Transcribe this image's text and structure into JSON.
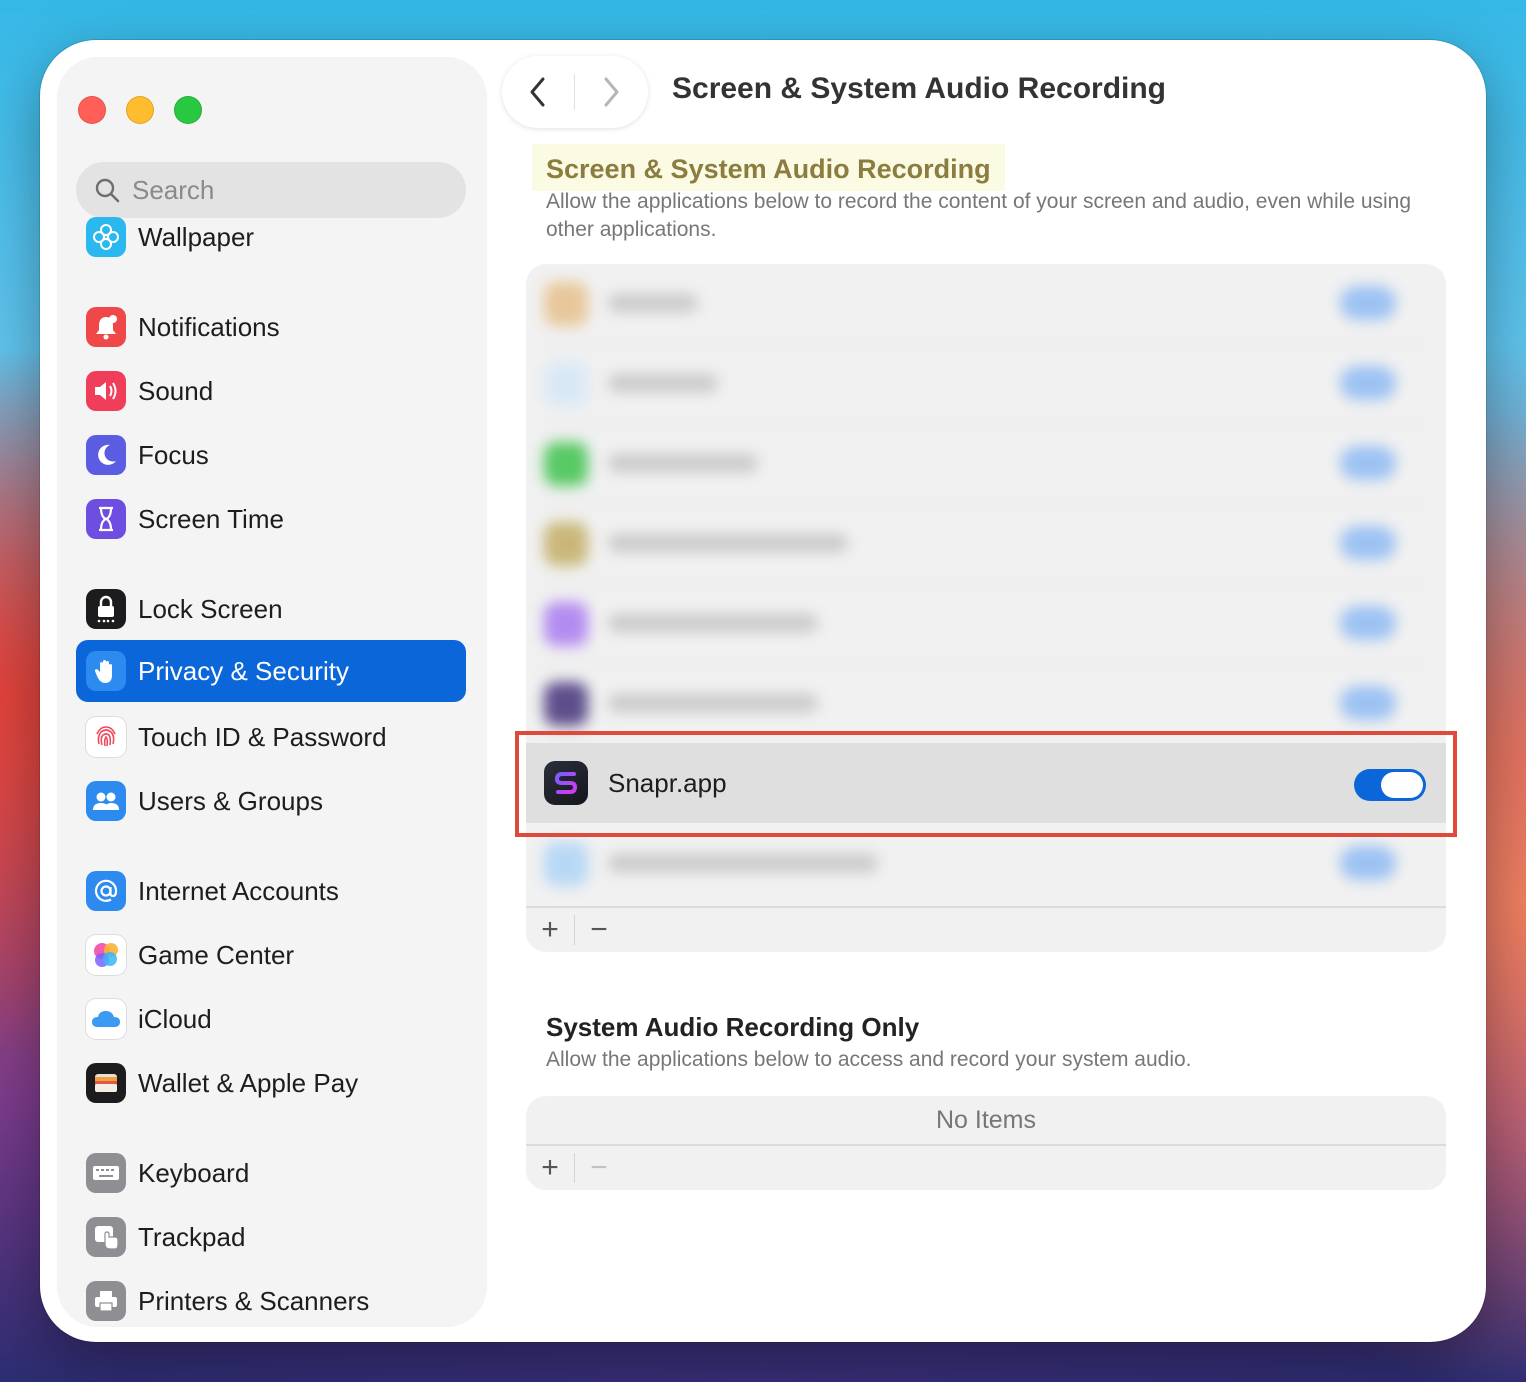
{
  "window": {
    "traffic_lights": {
      "close": "#ff5f57",
      "minimize": "#febc2e",
      "zoom": "#28c840"
    }
  },
  "sidebar": {
    "search": {
      "placeholder": "Search",
      "icon": "search-icon"
    },
    "items": [
      {
        "id": "wallpaper",
        "label": "Wallpaper",
        "icon": "wallpaper-icon",
        "color": "#27b7ea"
      },
      {
        "id": "notifications",
        "label": "Notifications",
        "icon": "bell-icon",
        "color": "#f04848"
      },
      {
        "id": "sound",
        "label": "Sound",
        "icon": "speaker-icon",
        "color": "#f03e5a"
      },
      {
        "id": "focus",
        "label": "Focus",
        "icon": "moon-icon",
        "color": "#5b5ce2"
      },
      {
        "id": "screen-time",
        "label": "Screen Time",
        "icon": "hourglass-icon",
        "color": "#6e4ee0"
      },
      {
        "id": "lock-screen",
        "label": "Lock Screen",
        "icon": "lock-icon",
        "color": "#1c1c1e"
      },
      {
        "id": "privacy-security",
        "label": "Privacy & Security",
        "icon": "hand-icon",
        "color": "#2d8bf0",
        "selected": true
      },
      {
        "id": "touch-id",
        "label": "Touch ID & Password",
        "icon": "fingerprint-icon",
        "color": "#ffffff"
      },
      {
        "id": "users-groups",
        "label": "Users & Groups",
        "icon": "users-icon",
        "color": "#2d8bf0"
      },
      {
        "id": "internet-accounts",
        "label": "Internet Accounts",
        "icon": "at-icon",
        "color": "#2d8bf0"
      },
      {
        "id": "game-center",
        "label": "Game Center",
        "icon": "game-center-icon",
        "color": "#ffffff"
      },
      {
        "id": "icloud",
        "label": "iCloud",
        "icon": "cloud-icon",
        "color": "#ffffff"
      },
      {
        "id": "wallet",
        "label": "Wallet & Apple Pay",
        "icon": "wallet-icon",
        "color": "#1c1c1e"
      },
      {
        "id": "keyboard",
        "label": "Keyboard",
        "icon": "keyboard-icon",
        "color": "#8e8e93"
      },
      {
        "id": "trackpad",
        "label": "Trackpad",
        "icon": "trackpad-icon",
        "color": "#8e8e93"
      },
      {
        "id": "printers",
        "label": "Printers & Scanners",
        "icon": "printer-icon",
        "color": "#8e8e93"
      }
    ]
  },
  "toolbar": {
    "back_icon": "chevron-left-icon",
    "forward_icon": "chevron-right-icon",
    "title": "Screen & System Audio Recording"
  },
  "section1": {
    "title": "Screen & System Audio Recording",
    "description": "Allow the applications below to record the content of your screen and audio, even while using other applications.",
    "apps": [
      {
        "name": "Snapr.app",
        "enabled": true,
        "icon": "snapr-app-icon"
      }
    ],
    "add_label": "+",
    "remove_label": "−"
  },
  "section2": {
    "title": "System Audio Recording Only",
    "description": "Allow the applications below to access and record your system audio.",
    "empty_text": "No Items",
    "add_label": "+",
    "remove_label": "−"
  },
  "colors": {
    "accent": "#0a66d9",
    "highlight_border": "#e04a3a",
    "title_highlight_bg": "#fbfae3"
  }
}
